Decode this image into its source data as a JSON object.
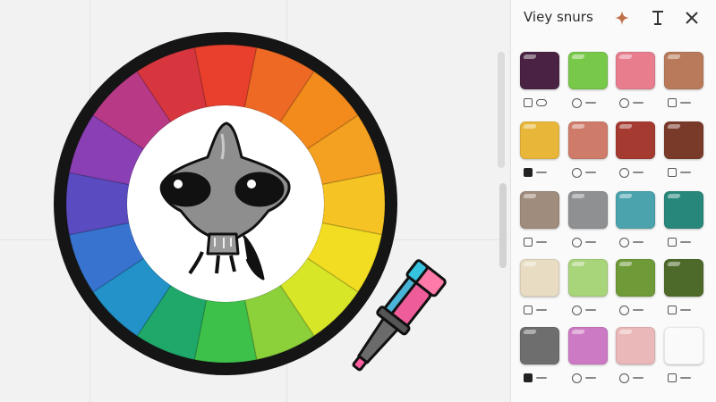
{
  "panel": {
    "title": "Viey snurs",
    "icons": [
      "sparkle-icon",
      "text-cursor-icon",
      "close-icon"
    ]
  },
  "wheel": {
    "segment_colors": [
      "#e8402c",
      "#ee6a24",
      "#f28a1c",
      "#f4a021",
      "#f6c324",
      "#f2dd22",
      "#d8e628",
      "#8cd03a",
      "#3ec14a",
      "#1fa86a",
      "#2292c8",
      "#3873cf",
      "#5a4cc0",
      "#8a3fb4",
      "#b83a86",
      "#d8363f"
    ],
    "ring_color": "#111111"
  },
  "swatches": [
    {
      "color": "#4a2344",
      "meta": "square-pill"
    },
    {
      "color": "#78c84a",
      "meta": "circle"
    },
    {
      "color": "#e87d8e",
      "meta": "circle"
    },
    {
      "color": "#b87a5a",
      "meta": "square"
    },
    {
      "color": "#e8b73a",
      "meta": "square-filled"
    },
    {
      "color": "#cf7b6a",
      "meta": "circle"
    },
    {
      "color": "#a53a30",
      "meta": "circle"
    },
    {
      "color": "#7a3a2a",
      "meta": "square"
    },
    {
      "color": "#a08c7c",
      "meta": "square"
    },
    {
      "color": "#8e9092",
      "meta": "circle"
    },
    {
      "color": "#4aa3ad",
      "meta": "circle"
    },
    {
      "color": "#26877a",
      "meta": "square"
    },
    {
      "color": "#e8dcc2",
      "meta": "square"
    },
    {
      "color": "#a8d47a",
      "meta": "circle"
    },
    {
      "color": "#6e9a38",
      "meta": "circle"
    },
    {
      "color": "#4e6a2a",
      "meta": "square"
    },
    {
      "color": "#6e6e6e",
      "meta": "square-filled"
    },
    {
      "color": "#cc7ac4",
      "meta": "circle"
    },
    {
      "color": "#eab8b8",
      "meta": "circle"
    },
    {
      "color": "#fafafa",
      "meta": "square"
    }
  ]
}
